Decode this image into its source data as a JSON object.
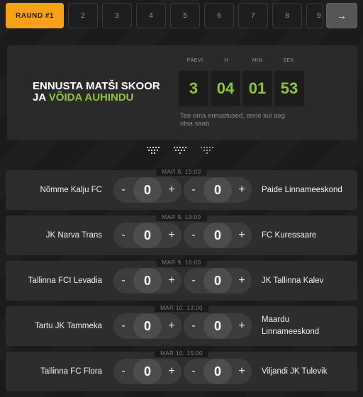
{
  "rounds": {
    "tabs": [
      "RAUND #1",
      "2",
      "3",
      "4",
      "5",
      "6",
      "7",
      "8",
      "9"
    ],
    "active_index": 0,
    "next_label": "→"
  },
  "countdown": {
    "headline_line1": "ENNUSTA MATŠI SKOOR",
    "headline_prefix": "JA ",
    "headline_accent": "VÕIDA AUHINDU",
    "units": [
      {
        "label": "PÄEVI",
        "value": "3"
      },
      {
        "label": "H",
        "value": "04"
      },
      {
        "label": "MIN",
        "value": "01"
      },
      {
        "label": "SEK",
        "value": "53"
      }
    ],
    "note": "Tee oma ennustused, enne kui aeg otsa saab"
  },
  "matches": [
    {
      "date": "MAR 8, 19:00",
      "home": "Nõmme Kalju FC",
      "away": "Paide Linnameeskond",
      "home_score": "0",
      "away_score": "0"
    },
    {
      "date": "MAR 9, 13:00",
      "home": "JK Narva Trans",
      "away": "FC Kuressaare",
      "home_score": "0",
      "away_score": "0"
    },
    {
      "date": "MAR 9, 16:00",
      "home": "Tallinna FCI Levadia",
      "away": "JK Tallinna Kalev",
      "home_score": "0",
      "away_score": "0"
    },
    {
      "date": "MAR 10, 13:00",
      "home": "Tartu JK Tammeka",
      "away": "Maardu Linnameeskond",
      "home_score": "0",
      "away_score": "0"
    },
    {
      "date": "MAR 10, 15:00",
      "home": "Tallinna FC Flora",
      "away": "Viljandi JK Tulevik",
      "home_score": "0",
      "away_score": "0"
    }
  ],
  "stepper": {
    "minus": "-",
    "plus": "+"
  },
  "colors": {
    "accent_orange": "#f7a11a",
    "accent_green": "#8dc63f",
    "panel": "#2d2d2d",
    "background": "#1b1b1b"
  }
}
